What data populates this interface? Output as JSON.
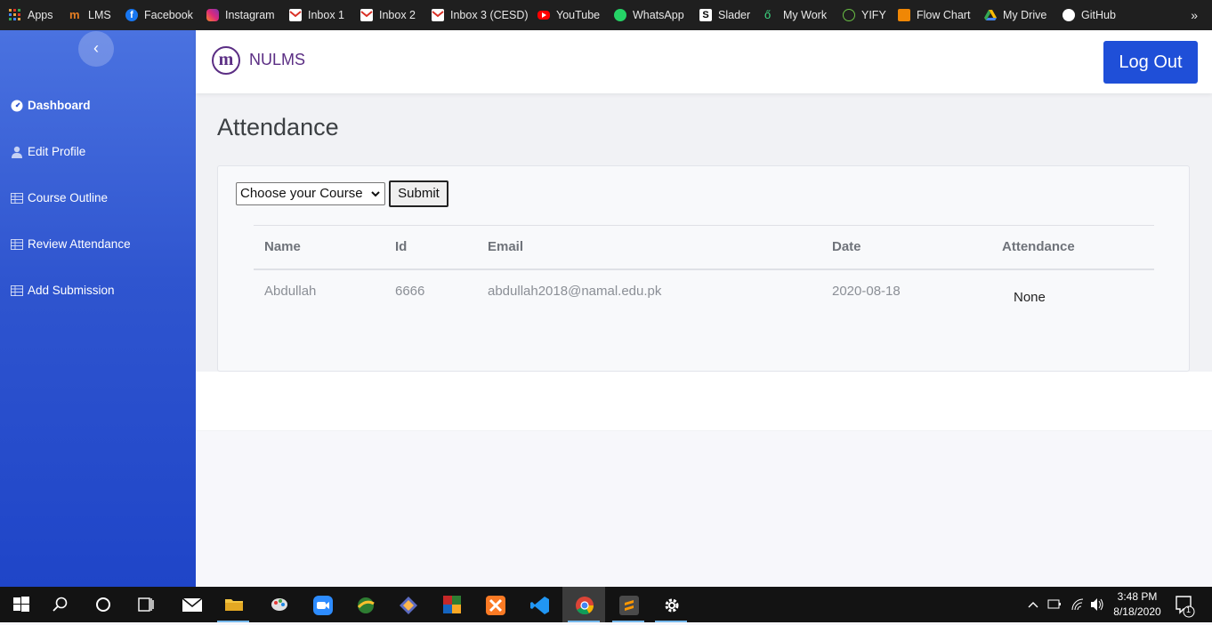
{
  "bookmarks": {
    "items": [
      {
        "label": "Apps",
        "icon": "apps-grid-icon",
        "color": "#e8a33d"
      },
      {
        "label": "LMS",
        "icon": "lms-icon",
        "color": "#e67e22"
      },
      {
        "label": "Facebook",
        "icon": "facebook-icon",
        "color": "#1877f2"
      },
      {
        "label": "Instagram",
        "icon": "instagram-icon",
        "color": "#d6249f"
      },
      {
        "label": "Inbox 1",
        "icon": "gmail-icon",
        "color": "#d93025"
      },
      {
        "label": "Inbox 2",
        "icon": "gmail-icon",
        "color": "#d93025"
      },
      {
        "label": "Inbox 3 (CESD)",
        "icon": "gmail-icon",
        "color": "#d93025"
      },
      {
        "label": "YouTube",
        "icon": "youtube-icon",
        "color": "#ff0000"
      },
      {
        "label": "WhatsApp",
        "icon": "whatsapp-icon",
        "color": "#25d366"
      },
      {
        "label": "Slader",
        "icon": "slader-icon",
        "color": "#ffffff"
      },
      {
        "label": "My Work",
        "icon": "my-work-icon",
        "color": "#3ddc84"
      },
      {
        "label": "YIFY",
        "icon": "yify-icon",
        "color": "#6ac045"
      },
      {
        "label": "Flow Chart",
        "icon": "flow-chart-icon",
        "color": "#f08705"
      },
      {
        "label": "My Drive",
        "icon": "google-drive-icon",
        "color": "#fbbc04"
      },
      {
        "label": "GitHub",
        "icon": "github-icon",
        "color": "#ffffff"
      }
    ],
    "more": "»"
  },
  "sidebar": {
    "collapse_icon": "‹",
    "items": [
      {
        "label": "Dashboard",
        "icon": "dashboard-icon",
        "active": true
      },
      {
        "label": "Edit Profile",
        "icon": "user-icon"
      },
      {
        "label": "Course Outline",
        "icon": "table-icon"
      },
      {
        "label": "Review Attendance",
        "icon": "table-icon"
      },
      {
        "label": "Add Submission",
        "icon": "table-icon"
      }
    ]
  },
  "header": {
    "brand": "NULMS",
    "logo_letter": "m",
    "logout_label": "Log Out"
  },
  "main": {
    "title": "Attendance",
    "course_select": {
      "selected": "Choose your Course"
    },
    "submit_label": "Submit",
    "table": {
      "columns": [
        "Name",
        "Id",
        "Email",
        "Date",
        "Attendance"
      ],
      "rows": [
        [
          "Abdullah",
          "6666",
          "abdullah2018@namal.edu.pk",
          "2020-08-18",
          "None"
        ]
      ]
    }
  },
  "taskbar": {
    "time": "3:48 PM",
    "date": "8/18/2020",
    "notification_count": "1"
  },
  "colors": {
    "sidebar_top": "#4a72e0",
    "sidebar_bottom": "#1f45c8",
    "logout_button": "#1f4fd8",
    "brand": "#5b2e84"
  }
}
